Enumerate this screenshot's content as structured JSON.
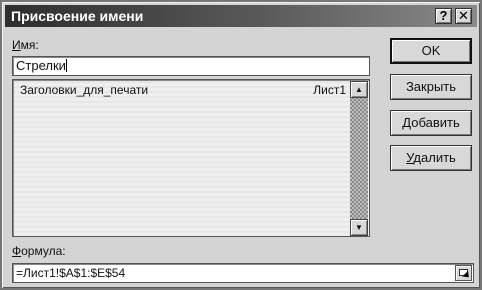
{
  "dialog": {
    "title": "Присвоение имени",
    "help_glyph": "?",
    "close_glyph": "✕"
  },
  "name_field": {
    "label_accel": "И",
    "label_rest": "мя:",
    "value": "Стрелки"
  },
  "names_list": {
    "items": [
      {
        "name": "Заголовки_для_печати",
        "sheet": "Лист1"
      }
    ],
    "scroll_up_glyph": "▲",
    "scroll_down_glyph": "▼"
  },
  "buttons": {
    "ok": "OK",
    "close": "Закрыть",
    "add_accel": "Д",
    "add_rest": "обавить",
    "delete_accel": "У",
    "delete_rest": "далить"
  },
  "formula_field": {
    "label_accel": "Ф",
    "label_rest": "ормула:",
    "value": "=Лист1!$A$1:$E$54"
  },
  "icons": {
    "help": "help-icon",
    "close": "close-icon",
    "collapse": "collapse-dialog-icon"
  }
}
